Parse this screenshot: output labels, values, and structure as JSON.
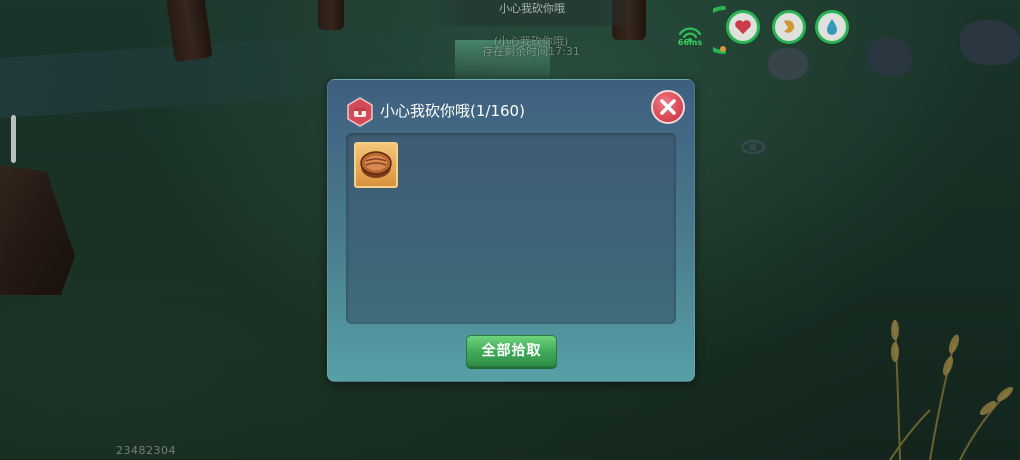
{
  "scene": {
    "banner_text": "小心我砍你哦",
    "background_text_1": "(小心我砍你哦)",
    "background_text_2": "存在剩余时间17:31",
    "player_id": "23482304"
  },
  "hud": {
    "latency": "66ms",
    "health_icon": "heart-icon",
    "hunger_icon": "stomach-icon",
    "water_icon": "water-drop-icon",
    "accent_color": "#2dc35a"
  },
  "dialog": {
    "title": "小心我砍你哦(1/160)",
    "title_icon": "chest-icon",
    "close_icon": "close-icon",
    "items": [
      {
        "icon": "round-wooden-item-icon"
      }
    ],
    "collect_all_label": "全部拾取"
  }
}
